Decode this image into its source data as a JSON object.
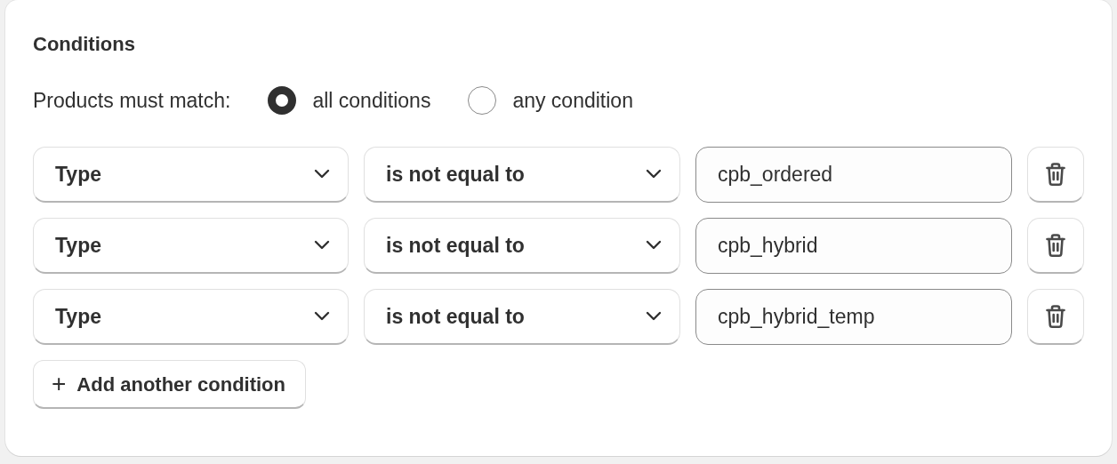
{
  "title": "Conditions",
  "match": {
    "label": "Products must match:",
    "options": [
      {
        "label": "all conditions",
        "selected": true
      },
      {
        "label": "any condition",
        "selected": false
      }
    ]
  },
  "conditions": [
    {
      "field": "Type",
      "operator": "is not equal to",
      "value": "cpb_ordered"
    },
    {
      "field": "Type",
      "operator": "is not equal to",
      "value": "cpb_hybrid"
    },
    {
      "field": "Type",
      "operator": "is not equal to",
      "value": "cpb_hybrid_temp"
    }
  ],
  "add_button": {
    "icon": "+",
    "label": "Add another condition"
  }
}
